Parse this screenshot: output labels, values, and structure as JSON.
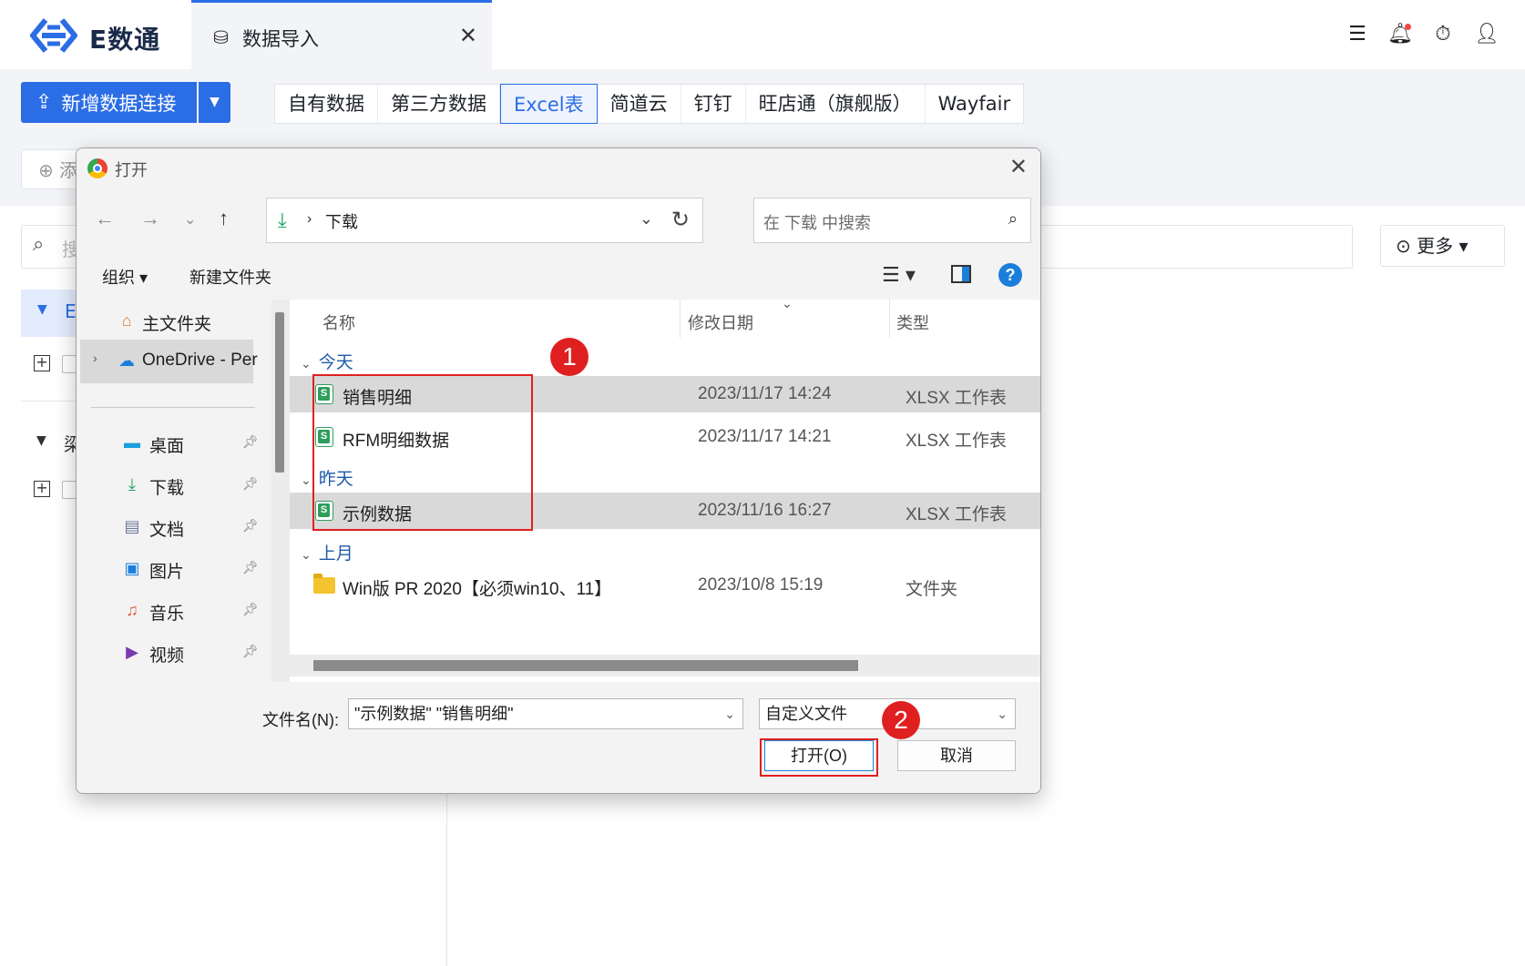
{
  "app": {
    "logo_text": "E数通",
    "active_tab": {
      "label": "数据导入",
      "close": "✕"
    }
  },
  "toolbar": {
    "new_connection_label": "新增数据连接",
    "source_tabs": [
      "自有数据",
      "第三方数据",
      "Excel表",
      "简道云",
      "钉钉",
      "旺店通（旗舰版）",
      "Wayfair"
    ],
    "active_source": "Excel表"
  },
  "background": {
    "add_button_char": "添",
    "search_placeholder_char": "搜",
    "more_label": "更多",
    "tree_item1_char": "E",
    "tree_item2_char": "梁"
  },
  "dialog": {
    "title": "打开",
    "address": {
      "path": "下载"
    },
    "search_placeholder": "在 下载 中搜索",
    "organize_label": "组织",
    "new_folder_label": "新建文件夹",
    "nav": {
      "home": "主文件夹",
      "onedrive": "OneDrive - Per",
      "items": [
        {
          "label": "桌面",
          "icon": "desktop-icon"
        },
        {
          "label": "下载",
          "icon": "download-icon"
        },
        {
          "label": "文档",
          "icon": "document-icon"
        },
        {
          "label": "图片",
          "icon": "pictures-icon"
        },
        {
          "label": "音乐",
          "icon": "music-icon"
        },
        {
          "label": "视频",
          "icon": "video-icon"
        }
      ]
    },
    "columns": {
      "name": "名称",
      "modified": "修改日期",
      "type": "类型"
    },
    "groups": {
      "today": "今天",
      "yesterday": "昨天",
      "last_month": "上月"
    },
    "files": [
      {
        "name": "销售明细",
        "date": "2023/11/17 14:24",
        "type": "XLSX 工作表",
        "selected": true
      },
      {
        "name": "RFM明细数据",
        "date": "2023/11/17 14:21",
        "type": "XLSX 工作表",
        "selected": false
      },
      {
        "name": "示例数据",
        "date": "2023/11/16 16:27",
        "type": "XLSX 工作表",
        "selected": true
      },
      {
        "name": "Win版 PR 2020【必须win10、11】",
        "date": "2023/10/8 15:19",
        "type": "文件夹",
        "selected": false
      }
    ],
    "filename_label": "文件名(N):",
    "filename_value": "\"示例数据\" \"销售明细\"",
    "filetype_value": "自定义文件",
    "open_label": "打开(O)",
    "cancel_label": "取消"
  },
  "annotations": {
    "badge1": "1",
    "badge2": "2"
  },
  "colors": {
    "accent": "#2b6de5",
    "annotation_red": "#e02020",
    "excel_green": "#2e9e5b"
  }
}
